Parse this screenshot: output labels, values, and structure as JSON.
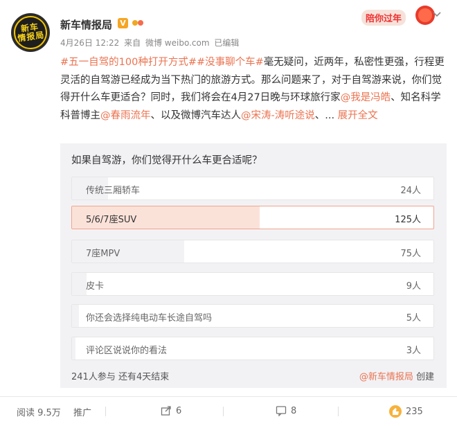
{
  "author": {
    "name": "新车情报局",
    "avatar_text_line1": "新车",
    "avatar_text_line2": "情报局",
    "vip_icon": "V"
  },
  "meta": {
    "date": "4月26日 12:22",
    "source_prefix": "来自",
    "source": "微博 weibo.com",
    "edited": "已编辑"
  },
  "festival_badge": "陪你过年",
  "post": {
    "tag1": "#五一自驾的100种打开方式#",
    "tag2": "#没事聊个车#",
    "text1": "毫无疑问，近两年，私密性更强，行程更灵活的自驾游已经成为当下热门的旅游方式。那么问题来了，对于自驾游来说，你们觉得开什么车更适合？同时，我们将会在4月27日晚与环球旅行家",
    "mention1": "@我是冯皓",
    "text2": "、知名科学科普博主",
    "mention2": "@春雨流年",
    "text3": "、以及微博汽车达人",
    "mention3": "@宋涛-涛听途说",
    "text4": "、...",
    "expand": "展开全文"
  },
  "poll": {
    "title": "如果自驾游，你们觉得开什么车更合适呢？",
    "options": [
      {
        "label": "传统三厢轿车",
        "count": "24人",
        "fraction": 0.1
      },
      {
        "label": "5/6/7座SUV",
        "count": "125人",
        "fraction": 0.52
      },
      {
        "label": "7座MPV",
        "count": "75人",
        "fraction": 0.31
      },
      {
        "label": "皮卡",
        "count": "9人",
        "fraction": 0.04
      },
      {
        "label": "你还会选择纯电动车长途自驾吗",
        "count": "5人",
        "fraction": 0.02
      },
      {
        "label": "评论区说说你的看法",
        "count": "3人",
        "fraction": 0.01
      }
    ],
    "selected_index": 1,
    "footer": "241人参与  还有4天结束",
    "creator": "@新车情报局",
    "creator_suffix": " 创建"
  },
  "actions": {
    "reads": "阅读 9.5万",
    "promote": "推广",
    "shares": "6",
    "comments": "8",
    "likes": "235"
  },
  "colors": {
    "accent": "#eb7350",
    "vip": "#f6a623",
    "poll_bg": "#f2f2f5",
    "selected_fill": "#fbe2d9"
  }
}
